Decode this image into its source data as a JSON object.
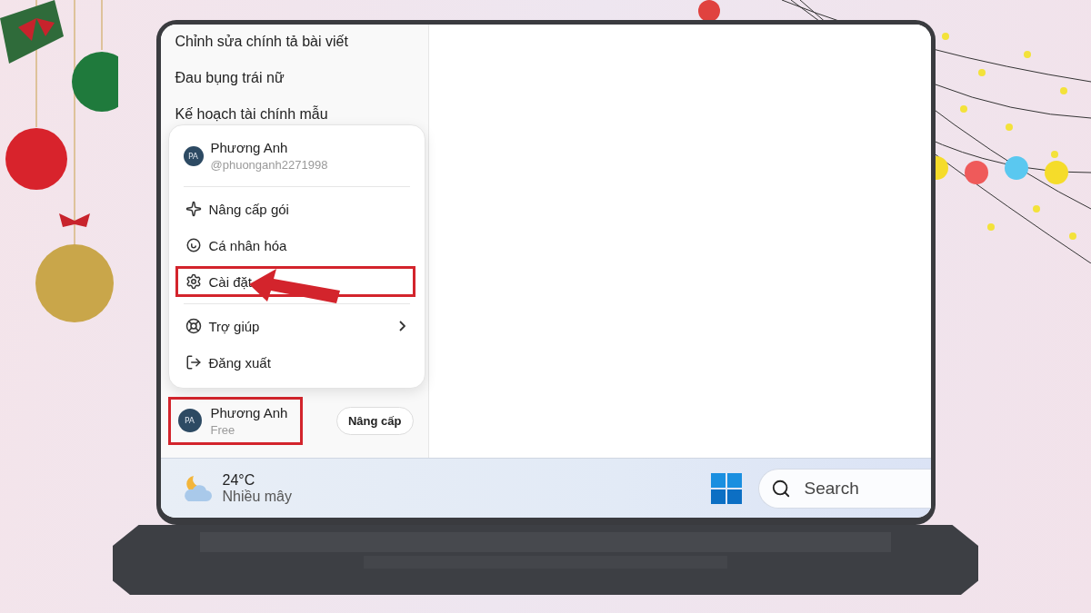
{
  "history": [
    {
      "title": "Chỉnh sửa chính tả bài viết"
    },
    {
      "title": "Đau bụng trái nữ"
    },
    {
      "title": "Kế hoạch tài chính mẫu"
    }
  ],
  "menu": {
    "header": {
      "initials": "PA",
      "name": "Phương Anh",
      "handle": "@phuonganh2271998"
    },
    "groups": [
      [
        {
          "kind": "upgrade",
          "label": "Nâng cấp gói",
          "highlighted": false,
          "submenu": false
        },
        {
          "kind": "personalize",
          "label": "Cá nhân hóa",
          "highlighted": false,
          "submenu": false
        },
        {
          "kind": "settings",
          "label": "Cài đặt",
          "highlighted": true,
          "submenu": false
        }
      ],
      [
        {
          "kind": "help",
          "label": "Trợ giúp",
          "highlighted": false,
          "submenu": true
        },
        {
          "kind": "logout",
          "label": "Đăng xuất",
          "highlighted": false,
          "submenu": false
        }
      ]
    ]
  },
  "user": {
    "initials": "PA",
    "name": "Phương Anh",
    "plan": "Free",
    "highlighted": true,
    "upgrade_button": "Nâng cấp"
  },
  "taskbar": {
    "temperature": "24°C",
    "weather": "Nhiều mây",
    "search": {
      "placeholder": "Search"
    }
  }
}
